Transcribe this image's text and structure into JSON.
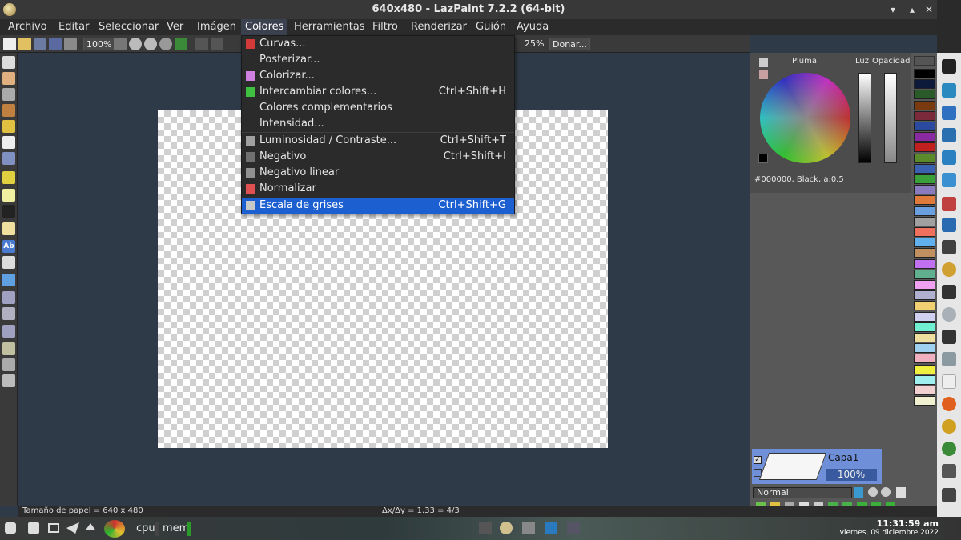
{
  "window": {
    "title": "640x480 - LazPaint 7.2.2 (64-bit)",
    "buttons": [
      "▾",
      "▴",
      "✕"
    ]
  },
  "menubar": [
    "Archivo",
    "Editar",
    "Seleccionar",
    "Ver",
    "Imágen",
    "Colores",
    "Herramientas",
    "Filtro",
    "Renderizar",
    "Guión",
    "Ayuda"
  ],
  "toolbar": {
    "zoom": "100%",
    "zoom2": "25%",
    "donate": "Donar..."
  },
  "colors_menu": {
    "items": [
      {
        "label": "Curvas...",
        "shortcut": "",
        "icon": "curves-icon",
        "color": "#d23a3a"
      },
      {
        "label": "Posterizar...",
        "shortcut": "",
        "icon": "",
        "color": ""
      },
      {
        "label": "Colorizar...",
        "shortcut": "",
        "icon": "colorize-icon",
        "color": "#d080e0"
      },
      {
        "label": "Intercambiar colores...",
        "shortcut": "Ctrl+Shift+H",
        "icon": "swap-colors-icon",
        "color": "#40c040"
      },
      {
        "label": "Colores complementarios",
        "shortcut": "",
        "icon": "",
        "color": ""
      },
      {
        "label": "Intensidad...",
        "shortcut": "",
        "icon": "",
        "color": ""
      },
      {
        "label": "Luminosidad / Contraste...",
        "shortcut": "Ctrl+Shift+T",
        "icon": "brightness-icon",
        "color": "#a0a0a0"
      },
      {
        "label": "Negativo",
        "shortcut": "Ctrl+Shift+I",
        "icon": "negative-icon",
        "color": "#707070"
      },
      {
        "label": "Negativo linear",
        "shortcut": "",
        "icon": "linear-negative-icon",
        "color": "#909090"
      },
      {
        "label": "Normalizar",
        "shortcut": "",
        "icon": "normalize-icon",
        "color": "#e05050"
      },
      {
        "label": "Escala de grises",
        "shortcut": "Ctrl+Shift+G",
        "icon": "grayscale-icon",
        "color": "#c8c8c8"
      }
    ]
  },
  "colorpanel": {
    "pen_label": "Pluma",
    "light_label": "Luz",
    "opacity_label": "Opacidad",
    "current": "#000000, Black, a:0.5"
  },
  "palette": [
    "#000000",
    "#0d1a3a",
    "#2a5a2a",
    "#7a3a10",
    "#7a2a3a",
    "#2a4aa0",
    "#8a2aa0",
    "#c02020",
    "#5a8a2a",
    "#3a60b0",
    "#3aa03a",
    "#8a7ac0",
    "#e07a3a",
    "#6aa0e0",
    "#a0a0a0",
    "#f07060",
    "#60b0f0",
    "#c09060",
    "#c070f0",
    "#60b090",
    "#f0a0f0",
    "#b0b0d0",
    "#f0d070",
    "#d0d0f0",
    "#70f0d0",
    "#f0e0a0",
    "#a0d0f0",
    "#f0b0c0",
    "#f0f040",
    "#a0f0f0",
    "#f0d0d0",
    "#f0f0d0"
  ],
  "layer": {
    "name": "Capa1",
    "opacity": "100%",
    "blend": "Normal"
  },
  "status": {
    "paper_size": "Tamaño de papel = 640 x 480",
    "ratio": "Δx/Δy = 1.33 = 4/3"
  },
  "taskbar": {
    "cpu": "cpu",
    "mem": "mem",
    "time": "11:31:59 am",
    "date": "viernes, 09 diciembre 2022"
  }
}
